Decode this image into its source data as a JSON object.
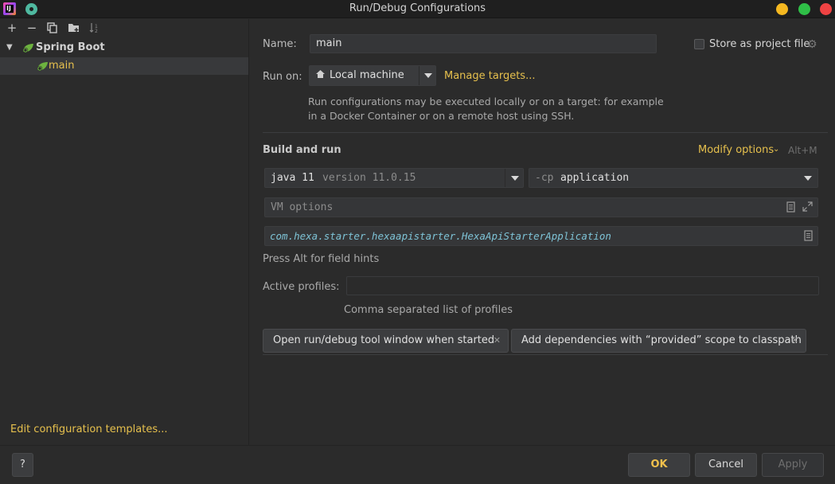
{
  "window": {
    "title": "Run/Debug Configurations"
  },
  "tree": {
    "group_label": "Spring Boot",
    "child_label": "main"
  },
  "left_footer": {
    "edit_templates": "Edit configuration templates..."
  },
  "form": {
    "name_label": "Name:",
    "name_value": "main",
    "store_label": "Store as project file",
    "run_on_label": "Run on:",
    "run_on_value": "Local machine",
    "manage_targets": "Manage targets...",
    "run_on_hint_1": "Run configurations may be executed locally or on a target: for example",
    "run_on_hint_2": "in a Docker Container or on a remote host using SSH.",
    "build_and_run": "Build and run",
    "modify_options": "Modify options",
    "modify_shortcut": "Alt+M",
    "jdk_name": "java 11",
    "jdk_version": "version 11.0.15",
    "cp_flag": "-cp",
    "cp_value": "application",
    "vm_options_placeholder": "VM options",
    "main_class": "com.hexa.starter.hexaapistarter.HexaApiStarterApplication",
    "field_hints": "Press Alt for field hints",
    "active_profiles_label": "Active profiles:",
    "active_profiles_value": "",
    "profiles_hint": "Comma separated list of profiles",
    "chips": [
      "Open run/debug tool window when started",
      "Add dependencies with “provided” scope to classpath"
    ]
  },
  "buttons": {
    "help": "?",
    "ok": "OK",
    "cancel": "Cancel",
    "apply": "Apply"
  },
  "colors": {
    "accent_link": "#e6c04d",
    "spring_green": "#6db33f",
    "background": "#2b2b2b"
  }
}
